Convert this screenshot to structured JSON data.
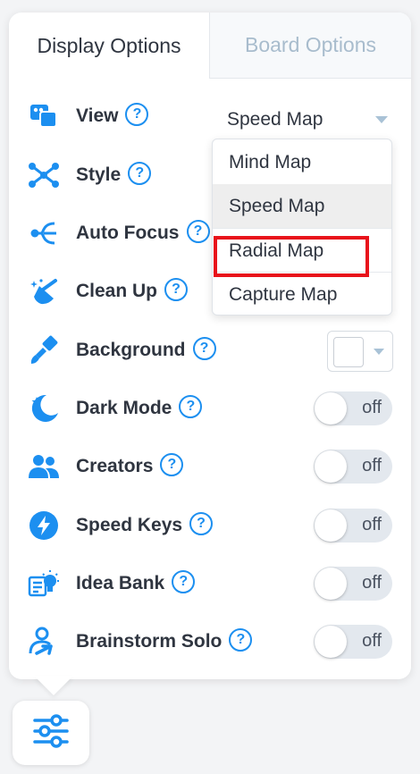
{
  "tabs": [
    {
      "label": "Display Options",
      "active": true
    },
    {
      "label": "Board Options",
      "active": false
    }
  ],
  "help_glyph": "?",
  "rows": {
    "view": {
      "label": "View",
      "icon": "view-icon",
      "value": "Speed Map"
    },
    "style": {
      "label": "Style",
      "icon": "style-icon"
    },
    "auto_focus": {
      "label": "Auto Focus",
      "icon": "auto-focus-icon"
    },
    "clean_up": {
      "label": "Clean Up",
      "icon": "clean-up-icon"
    },
    "background": {
      "label": "Background",
      "icon": "paintbrush-icon",
      "color": "#ffffff"
    },
    "dark_mode": {
      "label": "Dark Mode",
      "icon": "moon-icon",
      "toggle": "off"
    },
    "creators": {
      "label": "Creators",
      "icon": "people-icon",
      "toggle": "off"
    },
    "speed_keys": {
      "label": "Speed Keys",
      "icon": "lightning-icon",
      "toggle": "off"
    },
    "idea_bank": {
      "label": "Idea Bank",
      "icon": "lightbulb-icon",
      "toggle": "off"
    },
    "brainstorm_solo": {
      "label": "Brainstorm Solo",
      "icon": "person-arrow-icon",
      "toggle": "off"
    }
  },
  "view_dropdown": {
    "options": [
      "Mind Map",
      "Speed Map",
      "Radial Map",
      "Capture Map"
    ],
    "hovered": "Speed Map",
    "highlighted": "Radial Map"
  },
  "colors": {
    "accent": "#1c8ff0",
    "highlight_box": "#e8131b",
    "toggle_off": "#e3e8ee"
  },
  "fab": {
    "icon": "sliders-icon"
  }
}
